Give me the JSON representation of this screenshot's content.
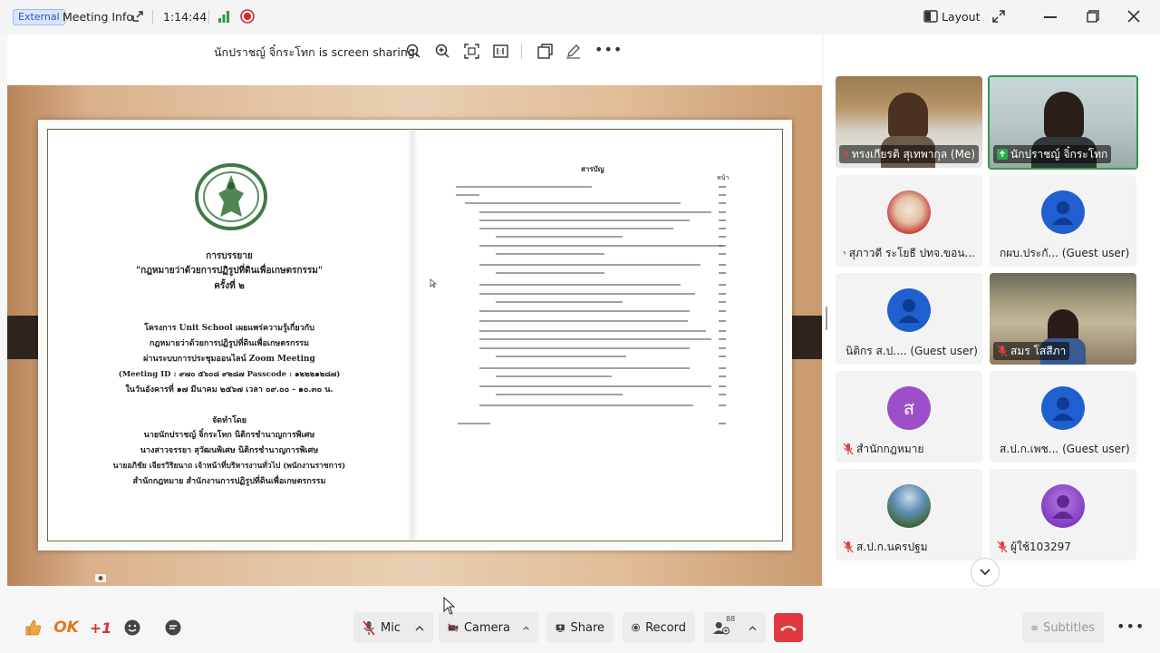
{
  "topbar": {
    "external_badge": "External",
    "meeting_info": "Meeting Info",
    "timer": "1:14:44",
    "layout_label": "Layout"
  },
  "share": {
    "sharing_text": "นักปราชญ์ จิ๋กระโทก is screen sharing."
  },
  "document": {
    "left_page": {
      "title_lines": [
        "การบรรยาย",
        "\"กฎหมายว่าด้วยการปฏิรูปที่ดินเพื่อเกษตรกรรม\"",
        "ครั้งที่ ๒"
      ],
      "project_lines": [
        "โครงการ Unit School เผยแพร่ความรู้เกี่ยวกับ",
        "กฎหมายว่าด้วยการปฏิรูปที่ดินเพื่อเกษตรกรรม",
        "ผ่านระบบการประชุมออนไลน์ Zoom Meeting",
        "(Meeting ID : ๙๗๐ ๕๖๐๘ ๙๒๘๗ Passcode : ๑๒๒๒๑๒๘๗)",
        "ในวันอังคารที่ ๑๗ มีนาคม ๒๕๖๗ เวลา ๐๙.๐๐ - ๑๐.๓๐ น."
      ],
      "organizer_heading": "จัดทำโดย",
      "organizer_lines": [
        "นายนักปราชญ์  จิ๋กระโทก นิติกรชำนาญการพิเศษ",
        "นางสาวจรรยา  สุวัฒนพิเศษ นิติกรชำนาญการพิเศษ",
        "นายอภิชัย เจียรวิริยนาถ เจ้าหน้าที่บริหารงานทั่วไป (พนักงานราชการ)",
        "สำนักกฎหมาย สำนักงานการปฏิรูปที่ดินเพื่อเกษตรกรรม"
      ]
    },
    "right_page": {
      "toc_heading": "สารบัญ",
      "page_col": "หน้า"
    }
  },
  "participants": [
    {
      "name": "ทรงเกียรติ สุเทพากุล (Me)",
      "type": "video",
      "muted": true,
      "active": false
    },
    {
      "name": "นักปราชญ์ จิ๋กระโทก",
      "type": "video",
      "muted": false,
      "sharing": true,
      "active": true
    },
    {
      "name": "สุภาวดี ระโยธี ปทจ.ขอน...",
      "type": "photo",
      "muted": true
    },
    {
      "name": "กผบ.ประกั... (Guest user)",
      "type": "avatar",
      "color": "#1f5fd0",
      "muted": true
    },
    {
      "name": "นิติกร ส.ป.... (Guest user)",
      "type": "avatar",
      "color": "#1f5fd0",
      "muted": true
    },
    {
      "name": "สมร โสสีภา",
      "type": "video",
      "muted": true
    },
    {
      "name": "สำนักกฎหมาย",
      "type": "avatar",
      "initial": "ส",
      "color": "#9b4fc9",
      "muted": true
    },
    {
      "name": "ส.ป.ก.เพช... (Guest user)",
      "type": "avatar",
      "color": "#1f5fd0",
      "muted": true
    },
    {
      "name": "ส.ป.ก.นครปฐม",
      "type": "photo",
      "muted": true
    },
    {
      "name": "ผู้ใช้103297",
      "type": "avatar",
      "color": "#8a45c8",
      "muted": true
    }
  ],
  "bottombar": {
    "ok_label": "OK",
    "plus_one": "+1",
    "mic_label": "Mic",
    "camera_label": "Camera",
    "share_label": "Share",
    "record_label": "Record",
    "participants_count": "88",
    "subtitles_label": "Subtitles"
  },
  "colors": {
    "end_call": "#e0383e",
    "record_dot": "#d62a2a",
    "signal": "#2e9a44",
    "active_border": "#2f9a4a"
  }
}
